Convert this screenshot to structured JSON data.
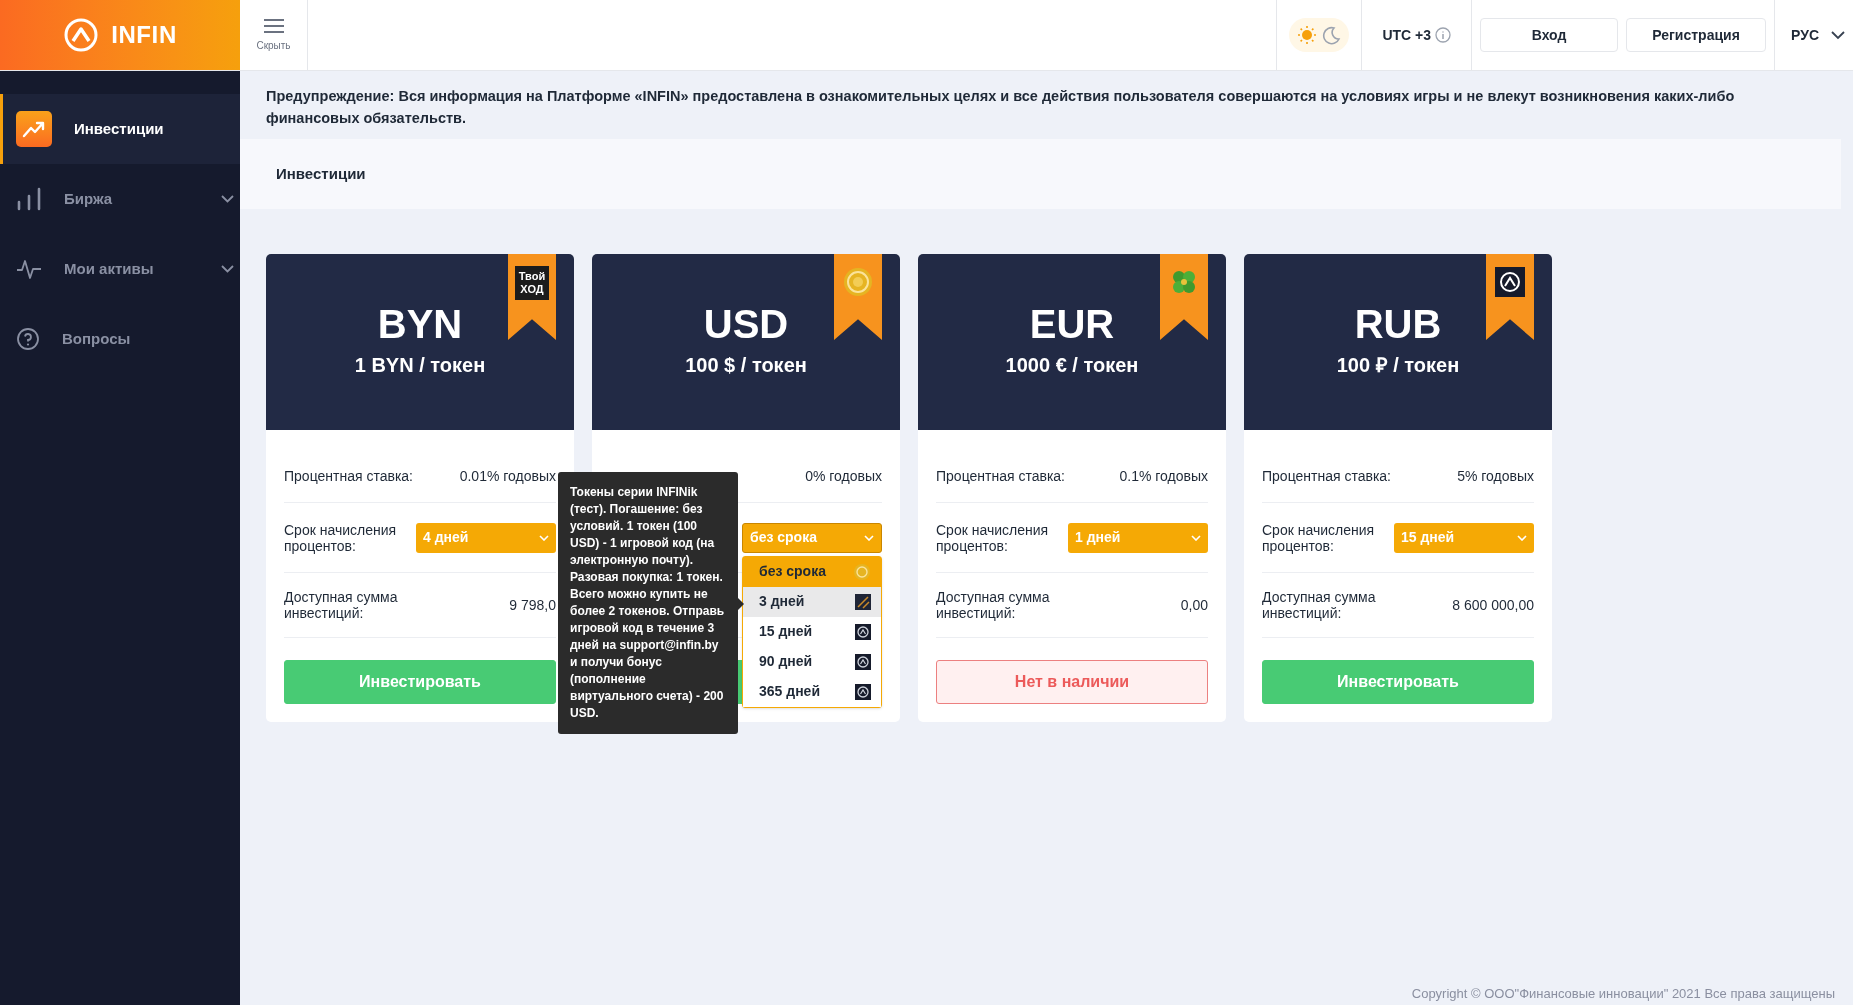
{
  "brand": {
    "name": "INFIN"
  },
  "hide_button": {
    "label": "Скрыть"
  },
  "topbar": {
    "dark_mode": false,
    "timezone": "UTC +3",
    "login": "Вход",
    "register": "Регистрация",
    "language": "РУС"
  },
  "sidebar": {
    "items": [
      {
        "label": "Инвестиции",
        "selected": true,
        "expandable": false
      },
      {
        "label": "Биржа",
        "selected": false,
        "expandable": true
      },
      {
        "label": "Мои активы",
        "selected": false,
        "expandable": true
      },
      {
        "label": "Вопросы",
        "selected": false,
        "expandable": false
      }
    ]
  },
  "warning": "Предупреждение: Вся информация на Платформе «INFIN» предоставлена в ознакомительных целях и все действия пользователя совершаются на условиях игры и не влекут возникновения каких-либо финансовых обязательств.",
  "breadcrumb": "Инвестиции",
  "cards": [
    {
      "currency": "BYN",
      "price": "1 BYN / токен",
      "badge": {
        "kind": "text",
        "text": "Твой ХОД"
      },
      "rate_label": "Процентная ставка:",
      "rate_value": "0.01% годовых",
      "term_label": "Срок начисления процентов:",
      "term": {
        "value": "4 дней",
        "open": false
      },
      "amount_label": "Доступная сумма инвестиций:",
      "amount": "9 798,0",
      "button": {
        "kind": "invest",
        "label": "Инвестировать"
      }
    },
    {
      "currency": "USD",
      "price": "100 $ / токен",
      "badge": {
        "kind": "coin"
      },
      "rate_value": "0% годовых",
      "term": {
        "value": "без срока",
        "open": true,
        "options": [
          {
            "label": "без срока",
            "selected": true,
            "highlighted": false
          },
          {
            "label": "3 дней",
            "selected": false,
            "highlighted": true
          },
          {
            "label": "15 дней",
            "selected": false,
            "highlighted": false
          },
          {
            "label": "90 дней",
            "selected": false,
            "highlighted": false
          },
          {
            "label": "365 дней",
            "selected": false,
            "highlighted": false
          }
        ]
      },
      "button": {
        "kind": "invest"
      },
      "tooltip": "Токены серии INFINik (тест). Погашение: без условий. 1 токен (100 USD) - 1 игровой код (на электронную почту). Разовая покупка: 1 токен. Всего можно купить не более 2 токенов. Отправь игровой код в течение 3 дней на support@infin.by и получи бонус (пополнение виртуального счета) - 200 USD."
    },
    {
      "currency": "EUR",
      "price": "1000 € / токен",
      "badge": {
        "kind": "clover"
      },
      "rate_label": "Процентная ставка:",
      "rate_value": "0.1% годовых",
      "term_label": "Срок начисления процентов:",
      "term": {
        "value": "1 дней",
        "open": false
      },
      "amount_label": "Доступная сумма инвестиций:",
      "amount": "0,00",
      "button": {
        "kind": "unavailable",
        "label": "Нет в наличии"
      }
    },
    {
      "currency": "RUB",
      "price": "100 ₽ / токен",
      "badge": {
        "kind": "logo"
      },
      "rate_label": "Процентная ставка:",
      "rate_value": "5% годовых",
      "term_label": "Срок начисления процентов:",
      "term": {
        "value": "15 дней",
        "open": false
      },
      "amount_label": "Доступная сумма инвестиций:",
      "amount": "8 600 000,00",
      "button": {
        "kind": "invest",
        "label": "Инвестировать"
      }
    }
  ],
  "footer": "Copyright © ООО\"Финансовые инновации\" 2021 Все права защищены"
}
